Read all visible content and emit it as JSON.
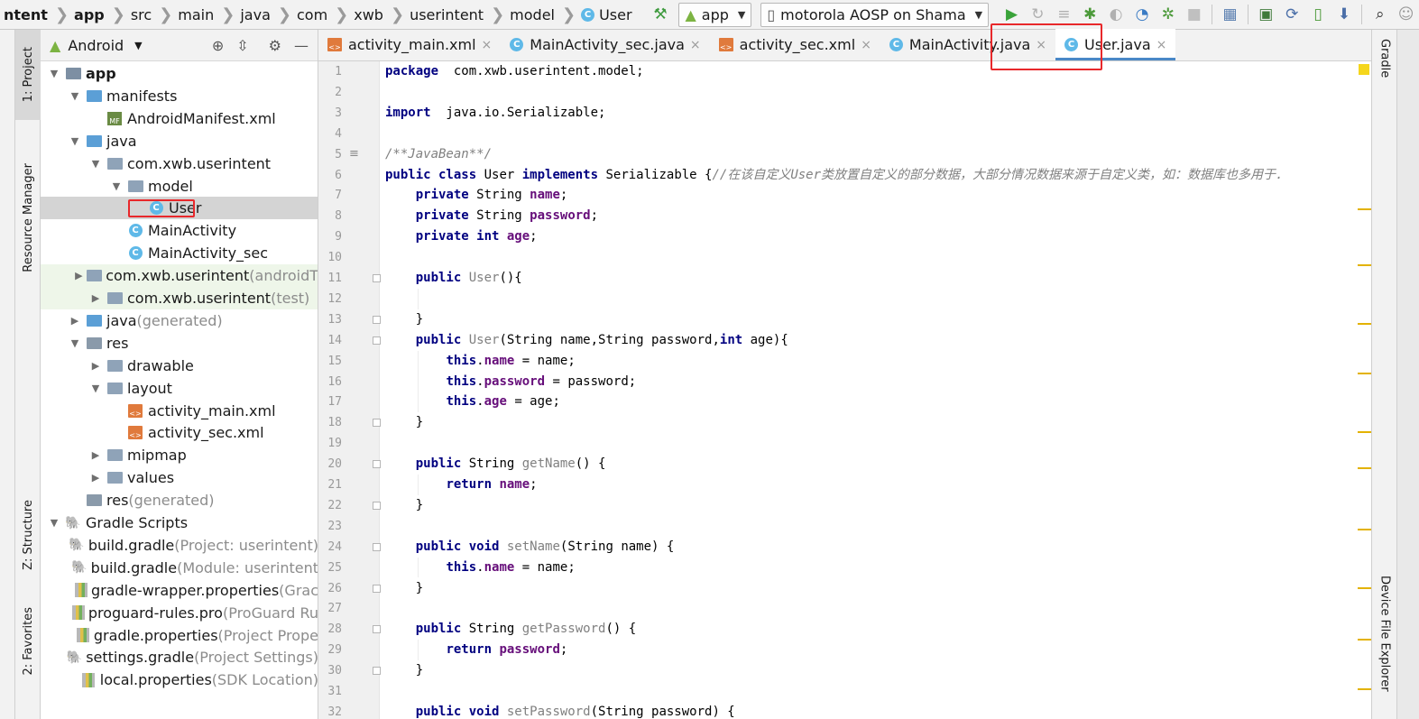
{
  "navbar": {
    "breadcrumbs": [
      "ntent",
      "app",
      "src",
      "main",
      "java",
      "com",
      "xwb",
      "userintent",
      "model",
      "User"
    ],
    "run_config": "app",
    "device": "motorola AOSP on Shama"
  },
  "tool_windows": {
    "left": [
      "1: Project",
      "Resource Manager",
      "Z: Structure",
      "2: Favorites"
    ],
    "right": [
      "Gradle",
      "Device File Explorer"
    ]
  },
  "project_panel": {
    "view_mode": "Android",
    "tree": [
      {
        "label": "app",
        "suffix": "",
        "depth": 0,
        "arrow": "▼",
        "icon": "app-module-icon",
        "bold": true
      },
      {
        "label": "manifests",
        "suffix": "",
        "depth": 1,
        "arrow": "▼",
        "icon": "folder-icon"
      },
      {
        "label": "AndroidManifest.xml",
        "suffix": "",
        "depth": 2,
        "arrow": "",
        "icon": "manifest-icon"
      },
      {
        "label": "java",
        "suffix": "",
        "depth": 1,
        "arrow": "▼",
        "icon": "folder-icon"
      },
      {
        "label": "com.xwb.userintent",
        "suffix": "",
        "depth": 2,
        "arrow": "▼",
        "icon": "package-icon"
      },
      {
        "label": "model",
        "suffix": "",
        "depth": 3,
        "arrow": "▼",
        "icon": "package-icon"
      },
      {
        "label": "User",
        "suffix": "",
        "depth": 4,
        "arrow": "",
        "icon": "class-icon",
        "selected": true
      },
      {
        "label": "MainActivity",
        "suffix": "",
        "depth": 3,
        "arrow": "",
        "icon": "class-icon"
      },
      {
        "label": "MainActivity_sec",
        "suffix": "",
        "depth": 3,
        "arrow": "",
        "icon": "class-icon"
      },
      {
        "label": "com.xwb.userintent",
        "suffix": " (androidT",
        "depth": 2,
        "arrow": "▶",
        "icon": "package-icon",
        "green": true
      },
      {
        "label": "com.xwb.userintent",
        "suffix": " (test)",
        "depth": 2,
        "arrow": "▶",
        "icon": "package-icon",
        "green": true
      },
      {
        "label": "java",
        "suffix": " (generated)",
        "depth": 1,
        "arrow": "▶",
        "icon": "folder-icon"
      },
      {
        "label": "res",
        "suffix": "",
        "depth": 1,
        "arrow": "▼",
        "icon": "res-folder-icon"
      },
      {
        "label": "drawable",
        "suffix": "",
        "depth": 2,
        "arrow": "▶",
        "icon": "package-icon"
      },
      {
        "label": "layout",
        "suffix": "",
        "depth": 2,
        "arrow": "▼",
        "icon": "package-icon"
      },
      {
        "label": "activity_main.xml",
        "suffix": "",
        "depth": 3,
        "arrow": "",
        "icon": "xml-icon"
      },
      {
        "label": "activity_sec.xml",
        "suffix": "",
        "depth": 3,
        "arrow": "",
        "icon": "xml-icon"
      },
      {
        "label": "mipmap",
        "suffix": "",
        "depth": 2,
        "arrow": "▶",
        "icon": "package-icon"
      },
      {
        "label": "values",
        "suffix": "",
        "depth": 2,
        "arrow": "▶",
        "icon": "package-icon"
      },
      {
        "label": "res",
        "suffix": " (generated)",
        "depth": 1,
        "arrow": "",
        "icon": "res-folder-icon"
      },
      {
        "label": "Gradle Scripts",
        "suffix": "",
        "depth": 0,
        "arrow": "▼",
        "icon": "gradle-icon"
      },
      {
        "label": "build.gradle",
        "suffix": " (Project: userintent)",
        "depth": 1,
        "arrow": "",
        "icon": "gradle-icon"
      },
      {
        "label": "build.gradle",
        "suffix": " (Module: userintent",
        "depth": 1,
        "arrow": "",
        "icon": "gradle-icon"
      },
      {
        "label": "gradle-wrapper.properties",
        "suffix": " (Grac",
        "depth": 1,
        "arrow": "",
        "icon": "properties-icon"
      },
      {
        "label": "proguard-rules.pro",
        "suffix": " (ProGuard Ru",
        "depth": 1,
        "arrow": "",
        "icon": "properties-icon"
      },
      {
        "label": "gradle.properties",
        "suffix": " (Project Prope",
        "depth": 1,
        "arrow": "",
        "icon": "properties-icon"
      },
      {
        "label": "settings.gradle",
        "suffix": " (Project Settings)",
        "depth": 1,
        "arrow": "",
        "icon": "gradle-icon"
      },
      {
        "label": "local.properties",
        "suffix": " (SDK Location)",
        "depth": 1,
        "arrow": "",
        "icon": "properties-icon"
      }
    ]
  },
  "editor_tabs": [
    {
      "label": "activity_main.xml",
      "icon": "xml-icon",
      "active": false
    },
    {
      "label": "MainActivity_sec.java",
      "icon": "class-icon",
      "active": false
    },
    {
      "label": "activity_sec.xml",
      "icon": "xml-icon",
      "active": false
    },
    {
      "label": "MainActivity.java",
      "icon": "class-icon",
      "active": false
    },
    {
      "label": "User.java",
      "icon": "class-icon",
      "active": true
    }
  ],
  "code": {
    "first_line": 1,
    "lines": [
      [
        [
          "kw",
          "package"
        ],
        [
          "",
          "  com.xwb.userintent.model;"
        ]
      ],
      [],
      [
        [
          "kw",
          "import"
        ],
        [
          "",
          "  java.io.Serializable;"
        ]
      ],
      [],
      [
        [
          "cmt",
          "/**JavaBean**/"
        ]
      ],
      [
        [
          "kw",
          "public class"
        ],
        [
          "",
          " User "
        ],
        [
          "kw",
          "implements"
        ],
        [
          "",
          " Serializable {"
        ],
        [
          "cmt",
          "//在该自定义User类放置自定义的部分数据，大部分情况数据来源于自定义类，如：数据库也多用于."
        ]
      ],
      [
        [
          "",
          "    "
        ],
        [
          "kw",
          "private"
        ],
        [
          "",
          " String "
        ],
        [
          "fld",
          "name"
        ],
        [
          "",
          ";"
        ]
      ],
      [
        [
          "",
          "    "
        ],
        [
          "kw",
          "private"
        ],
        [
          "",
          " String "
        ],
        [
          "fld",
          "password"
        ],
        [
          "",
          ";"
        ]
      ],
      [
        [
          "",
          "    "
        ],
        [
          "kw",
          "private int"
        ],
        [
          "",
          " "
        ],
        [
          "fld",
          "age"
        ],
        [
          "",
          ";"
        ]
      ],
      [],
      [
        [
          "",
          "    "
        ],
        [
          "kw",
          "public"
        ],
        [
          "",
          " "
        ],
        [
          "mth",
          "User"
        ],
        [
          "",
          "(){"
        ]
      ],
      [],
      [
        [
          "",
          "    }"
        ]
      ],
      [
        [
          "",
          "    "
        ],
        [
          "kw",
          "public"
        ],
        [
          "",
          " "
        ],
        [
          "mth",
          "User"
        ],
        [
          "",
          "(String name,String password,"
        ],
        [
          "kw",
          "int"
        ],
        [
          "",
          " age){"
        ]
      ],
      [
        [
          "",
          "        "
        ],
        [
          "kw",
          "this"
        ],
        [
          "",
          "."
        ],
        [
          "fld",
          "name"
        ],
        [
          "",
          " = name;"
        ]
      ],
      [
        [
          "",
          "        "
        ],
        [
          "kw",
          "this"
        ],
        [
          "",
          "."
        ],
        [
          "fld",
          "password"
        ],
        [
          "",
          " = password;"
        ]
      ],
      [
        [
          "",
          "        "
        ],
        [
          "kw",
          "this"
        ],
        [
          "",
          "."
        ],
        [
          "fld",
          "age"
        ],
        [
          "",
          " = age;"
        ]
      ],
      [
        [
          "",
          "    }"
        ]
      ],
      [],
      [
        [
          "",
          "    "
        ],
        [
          "kw",
          "public"
        ],
        [
          "",
          " String "
        ],
        [
          "mth",
          "getName"
        ],
        [
          "",
          "() {"
        ]
      ],
      [
        [
          "",
          "        "
        ],
        [
          "kw",
          "return"
        ],
        [
          "",
          " "
        ],
        [
          "fld",
          "name"
        ],
        [
          "",
          ";"
        ]
      ],
      [
        [
          "",
          "    }"
        ]
      ],
      [],
      [
        [
          "",
          "    "
        ],
        [
          "kw",
          "public void"
        ],
        [
          "",
          " "
        ],
        [
          "mth",
          "setName"
        ],
        [
          "",
          "(String name) {"
        ]
      ],
      [
        [
          "",
          "        "
        ],
        [
          "kw",
          "this"
        ],
        [
          "",
          "."
        ],
        [
          "fld",
          "name"
        ],
        [
          "",
          " = name;"
        ]
      ],
      [
        [
          "",
          "    }"
        ]
      ],
      [],
      [
        [
          "",
          "    "
        ],
        [
          "kw",
          "public"
        ],
        [
          "",
          " String "
        ],
        [
          "mth",
          "getPassword"
        ],
        [
          "",
          "() {"
        ]
      ],
      [
        [
          "",
          "        "
        ],
        [
          "kw",
          "return"
        ],
        [
          "",
          " "
        ],
        [
          "fld",
          "password"
        ],
        [
          "",
          ";"
        ]
      ],
      [
        [
          "",
          "    }"
        ]
      ],
      [],
      [
        [
          "",
          "    "
        ],
        [
          "kw",
          "public void"
        ],
        [
          "",
          " "
        ],
        [
          "mth",
          "setPassword"
        ],
        [
          "",
          "(String password) {"
        ]
      ]
    ]
  },
  "colors": {
    "keyword": "#000080",
    "field": "#660e7a",
    "comment": "#808080",
    "highlight_box": "#e8282b",
    "active_tab_underline": "#4a88c7"
  }
}
